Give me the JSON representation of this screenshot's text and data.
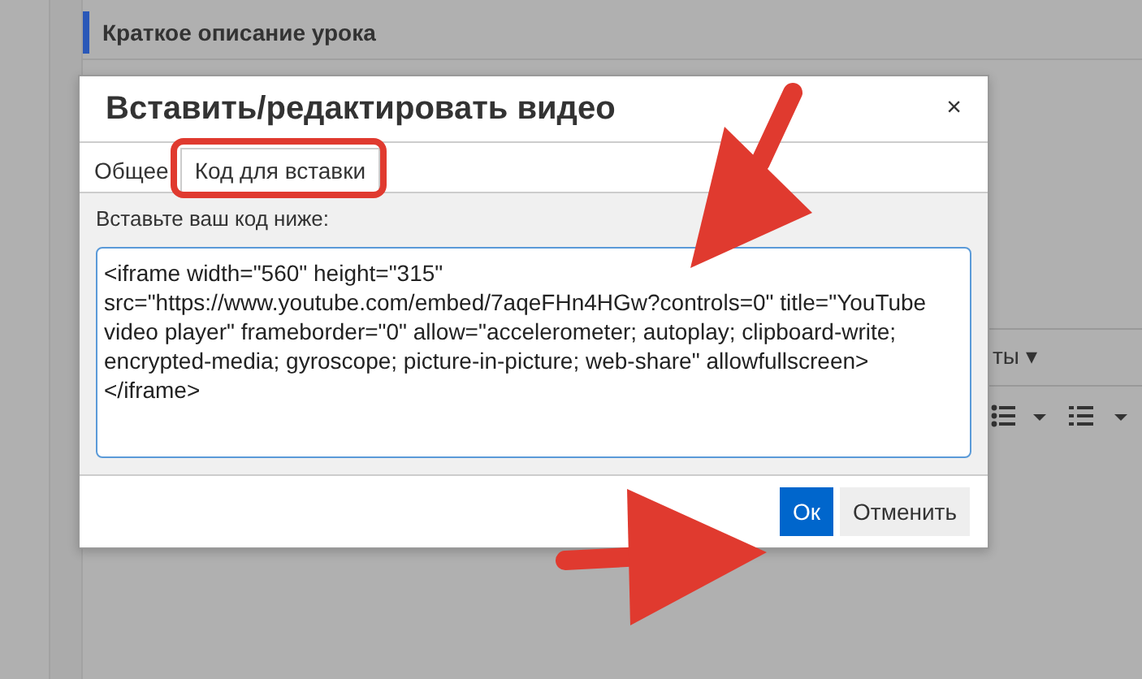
{
  "page": {
    "section_title": "Краткое описание урока",
    "toolbar_label": "ты",
    "toolbar_caret": "▾"
  },
  "dialog": {
    "title": "Вставить/редактировать видео",
    "close": "×",
    "tabs": [
      {
        "label": "Общее",
        "selected": false
      },
      {
        "label": "Код для вставки",
        "selected": true
      }
    ],
    "field_label": "Вставьте ваш код ниже:",
    "code": "<iframe width=\"560\" height=\"315\" src=\"https://www.youtube.com/embed/7aqeFHn4HGw?controls=0\" title=\"YouTube video player\" frameborder=\"0\" allow=\"accelerometer; autoplay; clipboard-write; encrypted-media; gyroscope; picture-in-picture; web-share\" allowfullscreen></iframe>",
    "buttons": [
      {
        "label": "Ок",
        "kind": "primary"
      },
      {
        "label": "Отменить",
        "kind": "secondary"
      }
    ]
  },
  "annotations": [
    {
      "kind": "frame"
    },
    {
      "kind": "arrow"
    },
    {
      "kind": "arrow"
    }
  ]
}
